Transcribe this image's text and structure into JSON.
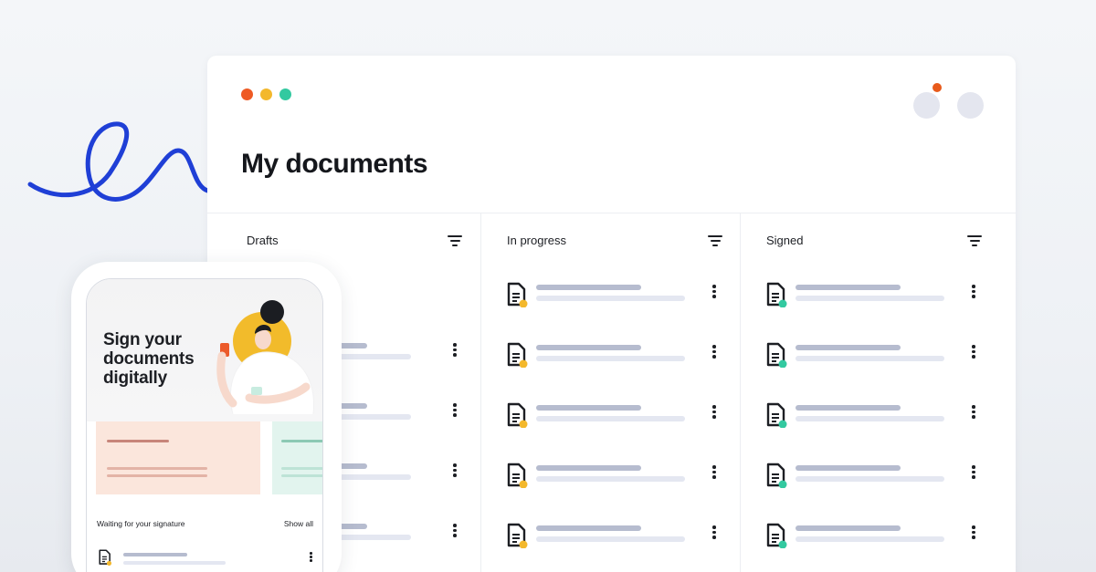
{
  "window": {
    "title": "My documents",
    "traffic_lights": [
      "#ee5a24",
      "#f3b82c",
      "#33c9a0"
    ],
    "notification_color": "#e85a1b"
  },
  "columns": [
    {
      "label": "Drafts",
      "status_color": "#f3b82c",
      "rows": 4
    },
    {
      "label": "In progress",
      "status_color": "#f3b82c",
      "rows": 5
    },
    {
      "label": "Signed",
      "status_color": "#33c9a0",
      "rows": 5
    }
  ],
  "phone": {
    "hero_line1": "Sign your",
    "hero_line2": "documents",
    "hero_line3": "digitally",
    "section_label": "Waiting for your signature",
    "show_all": "Show all"
  },
  "icons": [
    "document-icon",
    "filter-icon",
    "more-vertical-icon",
    "avatar"
  ]
}
